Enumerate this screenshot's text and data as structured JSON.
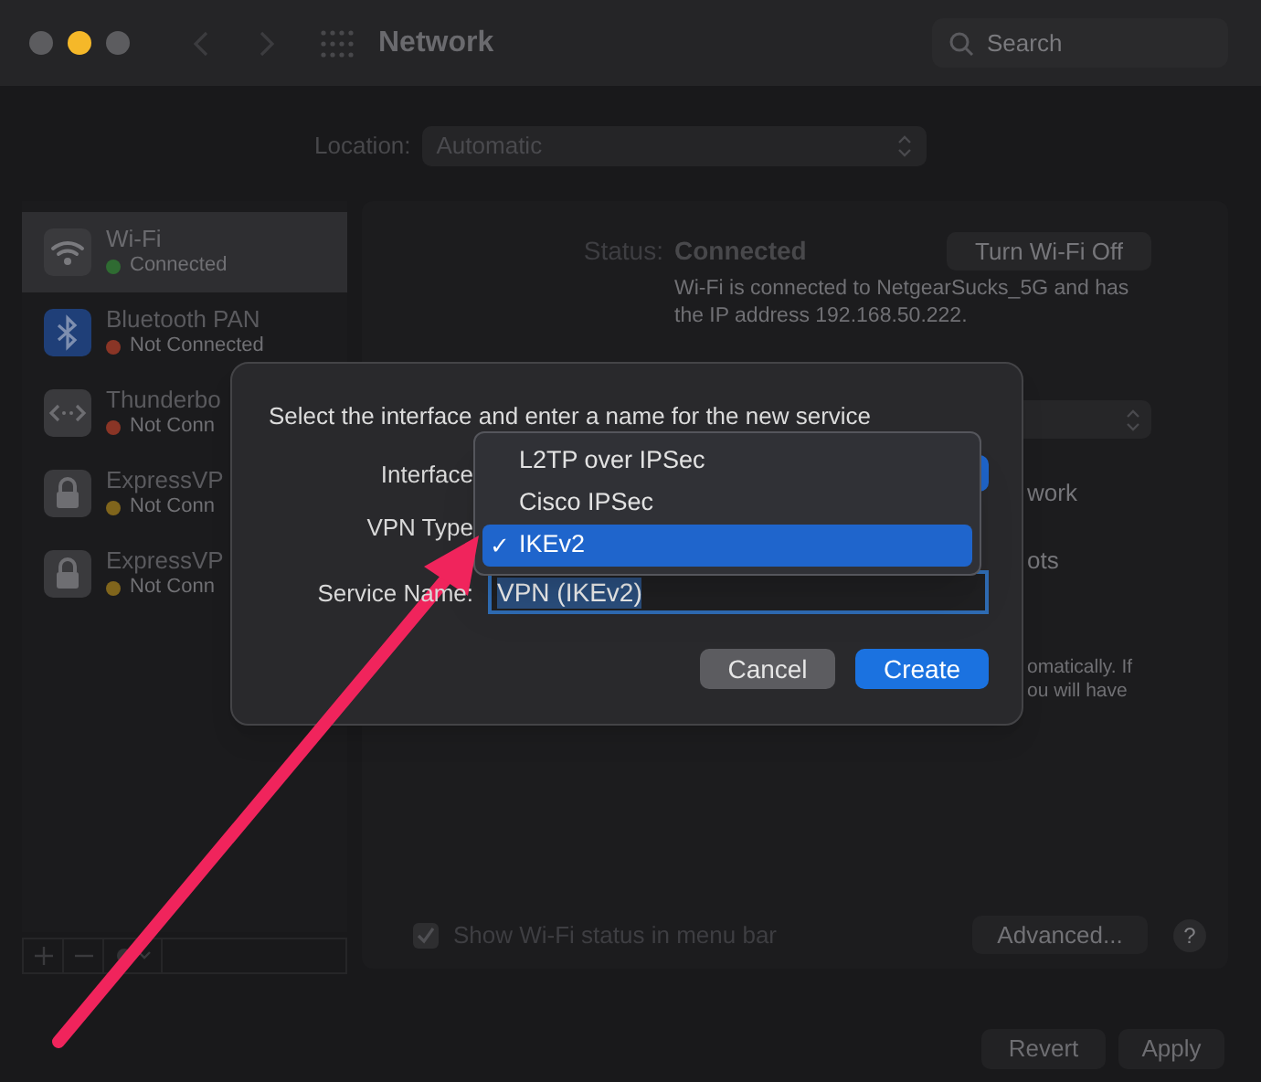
{
  "window": {
    "title": "Network"
  },
  "search": {
    "placeholder": "Search"
  },
  "location": {
    "label": "Location:",
    "value": "Automatic"
  },
  "sidebar": {
    "items": [
      {
        "kind": "wifi",
        "name": "Wi-Fi",
        "status": "Connected",
        "color": "#2f6b32",
        "selected": true
      },
      {
        "kind": "bluetooth",
        "name": "Bluetooth PAN",
        "status": "Not Connected",
        "color": "#8a3526",
        "selected": false
      },
      {
        "kind": "thunderbolt",
        "name": "Thunderbo",
        "status": "Not Conn",
        "color": "#8a3526",
        "selected": false
      },
      {
        "kind": "lock",
        "name": "ExpressVP",
        "status": "Not Conn",
        "color": "#80651c",
        "selected": false
      },
      {
        "kind": "lock",
        "name": "ExpressVP",
        "status": "Not Conn",
        "color": "#80651c",
        "selected": false
      }
    ]
  },
  "detail": {
    "status_label": "Status:",
    "status_value": "Connected",
    "turn_off_button": "Turn Wi-Fi Off",
    "description": "Wi-Fi is connected to NetgearSucks_5G and has the IP address 192.168.50.222.",
    "fragments": [
      "work",
      "ots",
      "omatically. If",
      "ou will have"
    ],
    "show_status": {
      "label": "Show Wi-Fi status in menu bar",
      "checked": true
    },
    "advanced_button": "Advanced...",
    "help_button": "?"
  },
  "footer": {
    "revert_button": "Revert",
    "apply_button": "Apply"
  },
  "dialog": {
    "title": "Select the interface and enter a name for the new service",
    "interface_label": "Interface",
    "vpn_type_label": "VPN Type",
    "service_name_label": "Service Name:",
    "vpn_type_menu": [
      {
        "label": "L2TP over IPSec",
        "selected": false
      },
      {
        "label": "Cisco IPSec",
        "selected": false
      },
      {
        "label": "IKEv2",
        "selected": true
      }
    ],
    "checkmark": "✓",
    "service_name": "VPN (IKEv2)",
    "cancel_button": "Cancel",
    "create_button": "Create"
  }
}
